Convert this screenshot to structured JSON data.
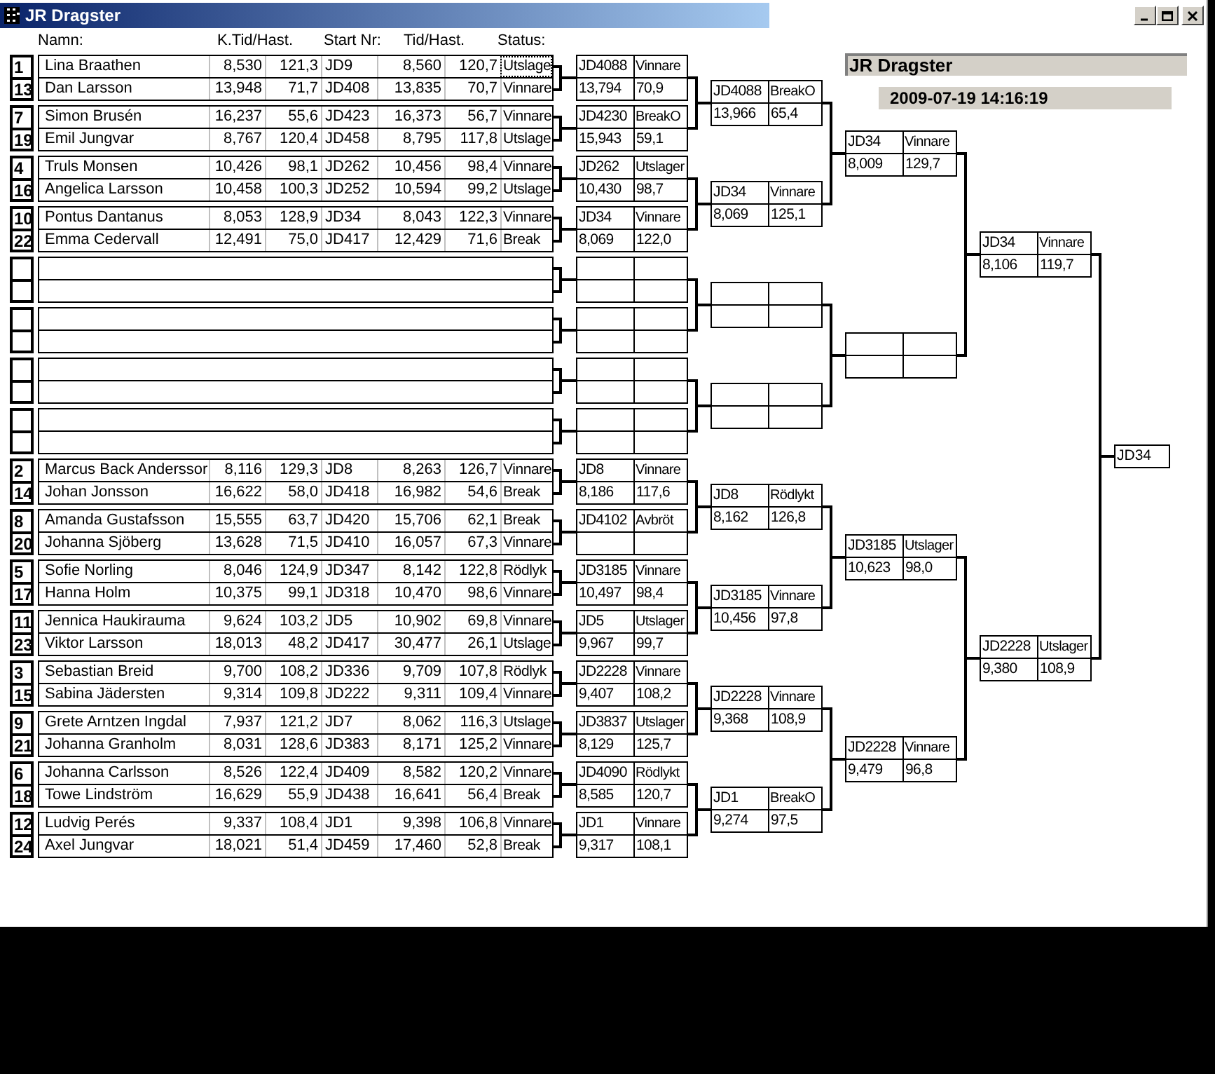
{
  "window": {
    "title": "JR Dragster"
  },
  "columns": [
    "Namn:",
    "K.Tid/Hast.",
    "Start Nr:",
    "Tid/Hast.",
    "Status:"
  ],
  "matches": [
    {
      "kind": "race",
      "racers": [
        {
          "seed": "1",
          "name": "Lina Braathen",
          "k_tid": "8,530",
          "k_hast": "121,3",
          "start_nr": "JD9",
          "tid": "8,560",
          "hast": "120,7",
          "status": "Utslage",
          "focused": true
        },
        {
          "seed": "13",
          "name": "Dan Larsson",
          "k_tid": "13,948",
          "k_hast": "71,7",
          "start_nr": "JD408",
          "tid": "13,835",
          "hast": "70,7",
          "status": "Vinnare",
          "focused": false
        }
      ]
    },
    {
      "kind": "race",
      "racers": [
        {
          "seed": "7",
          "name": "Simon Brusén",
          "k_tid": "16,237",
          "k_hast": "55,6",
          "start_nr": "JD423",
          "tid": "16,373",
          "hast": "56,7",
          "status": "Vinnare",
          "focused": false
        },
        {
          "seed": "19",
          "name": "Emil Jungvar",
          "k_tid": "8,767",
          "k_hast": "120,4",
          "start_nr": "JD458",
          "tid": "8,795",
          "hast": "117,8",
          "status": "Utslage",
          "focused": false
        }
      ]
    },
    {
      "kind": "race",
      "racers": [
        {
          "seed": "4",
          "name": "Truls Monsen",
          "k_tid": "10,426",
          "k_hast": "98,1",
          "start_nr": "JD262",
          "tid": "10,456",
          "hast": "98,4",
          "status": "Vinnare",
          "focused": false
        },
        {
          "seed": "16",
          "name": "Angelica Larsson",
          "k_tid": "10,458",
          "k_hast": "100,3",
          "start_nr": "JD252",
          "tid": "10,594",
          "hast": "99,2",
          "status": "Utslage",
          "focused": false
        }
      ]
    },
    {
      "kind": "race",
      "racers": [
        {
          "seed": "10",
          "name": "Pontus Dantanus",
          "k_tid": "8,053",
          "k_hast": "128,9",
          "start_nr": "JD34",
          "tid": "8,043",
          "hast": "122,3",
          "status": "Vinnare",
          "focused": false
        },
        {
          "seed": "22",
          "name": "Emma Cedervall",
          "k_tid": "12,491",
          "k_hast": "75,0",
          "start_nr": "JD417",
          "tid": "12,429",
          "hast": "71,6",
          "status": "Break",
          "focused": false
        }
      ]
    },
    {
      "kind": "empty"
    },
    {
      "kind": "empty"
    },
    {
      "kind": "empty"
    },
    {
      "kind": "empty"
    },
    {
      "kind": "race",
      "racers": [
        {
          "seed": "2",
          "name": "Marcus Back Anderssor",
          "k_tid": "8,116",
          "k_hast": "129,3",
          "start_nr": "JD8",
          "tid": "8,263",
          "hast": "126,7",
          "status": "Vinnare",
          "focused": false
        },
        {
          "seed": "14",
          "name": "Johan Jonsson",
          "k_tid": "16,622",
          "k_hast": "58,0",
          "start_nr": "JD418",
          "tid": "16,982",
          "hast": "54,6",
          "status": "Break",
          "focused": false
        }
      ]
    },
    {
      "kind": "race",
      "racers": [
        {
          "seed": "8",
          "name": "Amanda Gustafsson",
          "k_tid": "15,555",
          "k_hast": "63,7",
          "start_nr": "JD420",
          "tid": "15,706",
          "hast": "62,1",
          "status": "Break",
          "focused": false
        },
        {
          "seed": "20",
          "name": "Johanna Sjöberg",
          "k_tid": "13,628",
          "k_hast": "71,5",
          "start_nr": "JD410",
          "tid": "16,057",
          "hast": "67,3",
          "status": "Vinnare",
          "focused": false
        }
      ]
    },
    {
      "kind": "race",
      "racers": [
        {
          "seed": "5",
          "name": "Sofie Norling",
          "k_tid": "8,046",
          "k_hast": "124,9",
          "start_nr": "JD347",
          "tid": "8,142",
          "hast": "122,8",
          "status": "Rödlyk",
          "focused": false
        },
        {
          "seed": "17",
          "name": "Hanna Holm",
          "k_tid": "10,375",
          "k_hast": "99,1",
          "start_nr": "JD318",
          "tid": "10,470",
          "hast": "98,6",
          "status": "Vinnare",
          "focused": false
        }
      ]
    },
    {
      "kind": "race",
      "racers": [
        {
          "seed": "11",
          "name": "Jennica Haukirauma",
          "k_tid": "9,624",
          "k_hast": "103,2",
          "start_nr": "JD5",
          "tid": "10,902",
          "hast": "69,8",
          "status": "Vinnare",
          "focused": false
        },
        {
          "seed": "23",
          "name": "Viktor Larsson",
          "k_tid": "18,013",
          "k_hast": "48,2",
          "start_nr": "JD417",
          "tid": "30,477",
          "hast": "26,1",
          "status": "Utslage",
          "focused": false
        }
      ]
    },
    {
      "kind": "race",
      "racers": [
        {
          "seed": "3",
          "name": "Sebastian Breid",
          "k_tid": "9,700",
          "k_hast": "108,2",
          "start_nr": "JD336",
          "tid": "9,709",
          "hast": "107,8",
          "status": "Rödlyk",
          "focused": false
        },
        {
          "seed": "15",
          "name": "Sabina Jädersten",
          "k_tid": "9,314",
          "k_hast": "109,8",
          "start_nr": "JD222",
          "tid": "9,311",
          "hast": "109,4",
          "status": "Vinnare",
          "focused": false
        }
      ]
    },
    {
      "kind": "race",
      "racers": [
        {
          "seed": "9",
          "name": "Grete Arntzen Ingdal",
          "k_tid": "7,937",
          "k_hast": "121,2",
          "start_nr": "JD7",
          "tid": "8,062",
          "hast": "116,3",
          "status": "Utslage",
          "focused": false
        },
        {
          "seed": "21",
          "name": "Johanna Granholm",
          "k_tid": "8,031",
          "k_hast": "128,6",
          "start_nr": "JD383",
          "tid": "8,171",
          "hast": "125,2",
          "status": "Vinnare",
          "focused": false
        }
      ]
    },
    {
      "kind": "race",
      "racers": [
        {
          "seed": "6",
          "name": "Johanna Carlsson",
          "k_tid": "8,526",
          "k_hast": "122,4",
          "start_nr": "JD409",
          "tid": "8,582",
          "hast": "120,2",
          "status": "Vinnare",
          "focused": false
        },
        {
          "seed": "18",
          "name": "Towe Lindström",
          "k_tid": "16,629",
          "k_hast": "55,9",
          "start_nr": "JD438",
          "tid": "16,641",
          "hast": "56,4",
          "status": "Break",
          "focused": false
        }
      ]
    },
    {
      "kind": "race",
      "racers": [
        {
          "seed": "12",
          "name": "Ludvig Perés",
          "k_tid": "9,337",
          "k_hast": "108,4",
          "start_nr": "JD1",
          "tid": "9,398",
          "hast": "106,8",
          "status": "Vinnare",
          "focused": false
        },
        {
          "seed": "24",
          "name": "Axel Jungvar",
          "k_tid": "18,021",
          "k_hast": "51,4",
          "start_nr": "JD459",
          "tid": "17,460",
          "hast": "52,8",
          "status": "Break",
          "focused": false
        }
      ]
    }
  ],
  "rounds": [
    {
      "boxes": [
        {
          "kind": "result",
          "start_nr": "JD4088",
          "status": "Vinnare",
          "tid": "13,794",
          "hast": "70,9"
        },
        {
          "kind": "result",
          "start_nr": "JD4230",
          "status": "BreakO",
          "tid": "15,943",
          "hast": "59,1"
        },
        {
          "kind": "result",
          "start_nr": "JD262",
          "status": "Utslager",
          "tid": "10,430",
          "hast": "98,7"
        },
        {
          "kind": "result",
          "start_nr": "JD34",
          "status": "Vinnare",
          "tid": "8,069",
          "hast": "122,0"
        },
        {
          "kind": "empty"
        },
        {
          "kind": "empty"
        },
        {
          "kind": "empty"
        },
        {
          "kind": "empty"
        },
        {
          "kind": "result",
          "start_nr": "JD8",
          "status": "Vinnare",
          "tid": "8,186",
          "hast": "117,6"
        },
        {
          "kind": "result",
          "start_nr": "JD4102",
          "status": "Avbröt"
        },
        {
          "kind": "result",
          "start_nr": "JD3185",
          "status": "Vinnare",
          "tid": "10,497",
          "hast": "98,4"
        },
        {
          "kind": "result",
          "start_nr": "JD5",
          "status": "Utslager",
          "tid": "9,967",
          "hast": "99,7"
        },
        {
          "kind": "result",
          "start_nr": "JD2228",
          "status": "Vinnare",
          "tid": "9,407",
          "hast": "108,2"
        },
        {
          "kind": "result",
          "start_nr": "JD3837",
          "status": "Utslager",
          "tid": "8,129",
          "hast": "125,7"
        },
        {
          "kind": "result",
          "start_nr": "JD4090",
          "status": "Rödlykt",
          "tid": "8,585",
          "hast": "120,7"
        },
        {
          "kind": "result",
          "start_nr": "JD1",
          "status": "Vinnare",
          "tid": "9,317",
          "hast": "108,1"
        }
      ]
    },
    {
      "boxes": [
        {
          "kind": "result",
          "start_nr": "JD4088",
          "status": "BreakO",
          "tid": "13,966",
          "hast": "65,4"
        },
        {
          "kind": "result",
          "start_nr": "JD34",
          "status": "Vinnare",
          "tid": "8,069",
          "hast": "125,1"
        },
        {
          "kind": "empty"
        },
        {
          "kind": "empty"
        },
        {
          "kind": "result",
          "start_nr": "JD8",
          "status": "Rödlykt",
          "tid": "8,162",
          "hast": "126,8"
        },
        {
          "kind": "result",
          "start_nr": "JD3185",
          "status": "Vinnare",
          "tid": "10,456",
          "hast": "97,8"
        },
        {
          "kind": "result",
          "start_nr": "JD2228",
          "status": "Vinnare",
          "tid": "9,368",
          "hast": "108,9"
        },
        {
          "kind": "result",
          "start_nr": "JD1",
          "status": "BreakO",
          "tid": "9,274",
          "hast": "97,5"
        }
      ]
    },
    {
      "boxes": [
        {
          "kind": "result",
          "start_nr": "JD34",
          "status": "Vinnare",
          "tid": "8,009",
          "hast": "129,7"
        },
        {
          "kind": "empty"
        },
        {
          "kind": "result",
          "start_nr": "JD3185",
          "status": "Utslager",
          "tid": "10,623",
          "hast": "98,0"
        },
        {
          "kind": "result",
          "start_nr": "JD2228",
          "status": "Vinnare",
          "tid": "9,479",
          "hast": "96,8"
        }
      ]
    },
    {
      "boxes": [
        {
          "kind": "result",
          "start_nr": "JD34",
          "status": "Vinnare",
          "tid": "8,106",
          "hast": "119,7"
        },
        {
          "kind": "result",
          "start_nr": "JD2228",
          "status": "Utslager",
          "tid": "9,380",
          "hast": "108,9"
        }
      ]
    },
    {
      "boxes": [
        {
          "kind": "final",
          "start_nr": "JD34"
        }
      ]
    }
  ],
  "header": {
    "title": "JR Dragster",
    "timestamp": "2009-07-19 14:16:19"
  }
}
